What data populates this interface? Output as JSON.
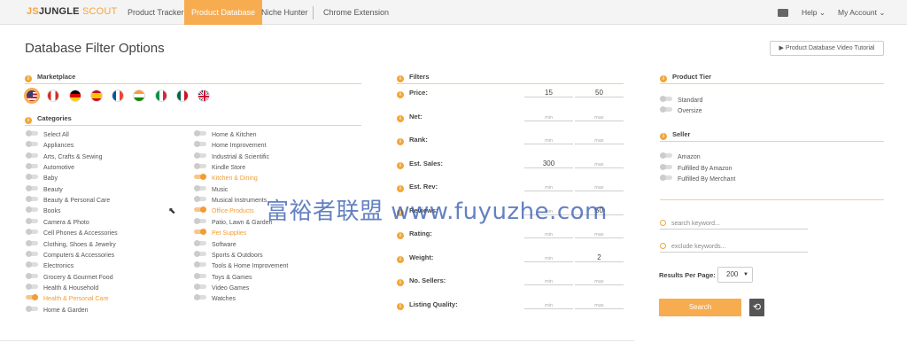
{
  "app": {
    "logo_mark": "JS",
    "logo_jungle": "JUNGLE",
    "logo_scout": " SCOUT"
  },
  "nav": {
    "tabs": [
      "Product Tracker",
      "Product Database",
      "Niche Hunter",
      "Chrome Extension"
    ],
    "active_index": 1,
    "help_label": "Help",
    "account_label": "My Account"
  },
  "page": {
    "title": "Database Filter Options",
    "video_button": "▶ Product Database Video Tutorial"
  },
  "marketplace": {
    "heading": "Marketplace",
    "flags": [
      "us-flag-icon",
      "ca-flag-icon",
      "de-flag-icon",
      "es-flag-icon",
      "fr-flag-icon",
      "in-flag-icon",
      "it-flag-icon",
      "mx-flag-icon",
      "uk-flag-icon"
    ],
    "selected": "us-flag-icon"
  },
  "categories": {
    "heading": "Categories",
    "left": [
      {
        "label": "Select All",
        "on": false
      },
      {
        "label": "Appliances",
        "on": false
      },
      {
        "label": "Arts, Crafts & Sewing",
        "on": false
      },
      {
        "label": "Automotive",
        "on": false
      },
      {
        "label": "Baby",
        "on": false
      },
      {
        "label": "Beauty",
        "on": false
      },
      {
        "label": "Beauty & Personal Care",
        "on": false
      },
      {
        "label": "Books",
        "on": false
      },
      {
        "label": "Camera & Photo",
        "on": false
      },
      {
        "label": "Cell Phones & Accessories",
        "on": false
      },
      {
        "label": "Clothing, Shoes & Jewelry",
        "on": false
      },
      {
        "label": "Computers & Accessories",
        "on": false
      },
      {
        "label": "Electronics",
        "on": false
      },
      {
        "label": "Grocery & Gourmet Food",
        "on": false
      },
      {
        "label": "Health & Household",
        "on": false
      },
      {
        "label": "Health & Personal Care",
        "on": true
      },
      {
        "label": "Home & Garden",
        "on": false
      }
    ],
    "right": [
      {
        "label": "Home & Kitchen",
        "on": false
      },
      {
        "label": "Home Improvement",
        "on": false
      },
      {
        "label": "Industrial & Scientific",
        "on": false
      },
      {
        "label": "Kindle Store",
        "on": false
      },
      {
        "label": "Kitchen & Dining",
        "on": true
      },
      {
        "label": "Music",
        "on": false
      },
      {
        "label": "Musical Instruments",
        "on": false
      },
      {
        "label": "Office Products",
        "on": true
      },
      {
        "label": "Patio, Lawn & Garden",
        "on": false
      },
      {
        "label": "Pet Supplies",
        "on": true
      },
      {
        "label": "Software",
        "on": false
      },
      {
        "label": "Sports & Outdoors",
        "on": false
      },
      {
        "label": "Tools & Home Improvement",
        "on": false
      },
      {
        "label": "Toys & Games",
        "on": false
      },
      {
        "label": "Video Games",
        "on": false
      },
      {
        "label": "Watches",
        "on": false
      }
    ]
  },
  "filters": {
    "heading": "Filters",
    "rows": [
      {
        "label": "Price:",
        "min": "15",
        "max": "50"
      },
      {
        "label": "Net:",
        "min": "",
        "max": ""
      },
      {
        "label": "Rank:",
        "min": "",
        "max": ""
      },
      {
        "label": "Est. Sales:",
        "min": "300",
        "max": ""
      },
      {
        "label": "Est. Rev:",
        "min": "",
        "max": ""
      },
      {
        "label": "Reviews:",
        "min": "",
        "max": "50"
      },
      {
        "label": "Rating:",
        "min": "",
        "max": ""
      },
      {
        "label": "Weight:",
        "min": "",
        "max": "2"
      },
      {
        "label": "No. Sellers:",
        "min": "",
        "max": ""
      },
      {
        "label": "Listing Quality:",
        "min": "",
        "max": ""
      }
    ],
    "min_placeholder": "min",
    "max_placeholder": "max"
  },
  "product_tier": {
    "heading": "Product Tier",
    "items": [
      "Standard",
      "Oversize"
    ]
  },
  "seller": {
    "heading": "Seller",
    "items": [
      "Amazon",
      "Fulfilled By Amazon",
      "Fulfilled By Merchant"
    ]
  },
  "search": {
    "keyword_placeholder": "search keyword...",
    "exclude_placeholder": "exclude keywords...",
    "results_label": "Results Per Page:",
    "results_value": "200",
    "search_button": "Search",
    "reset_icon": "reset-icon"
  },
  "watermark": "富裕者联盟 www.fuyuzhe.com",
  "colors": {
    "accent": "#f7ac4f",
    "rule": "#f3cf9c",
    "active_text": "#f29d34"
  }
}
